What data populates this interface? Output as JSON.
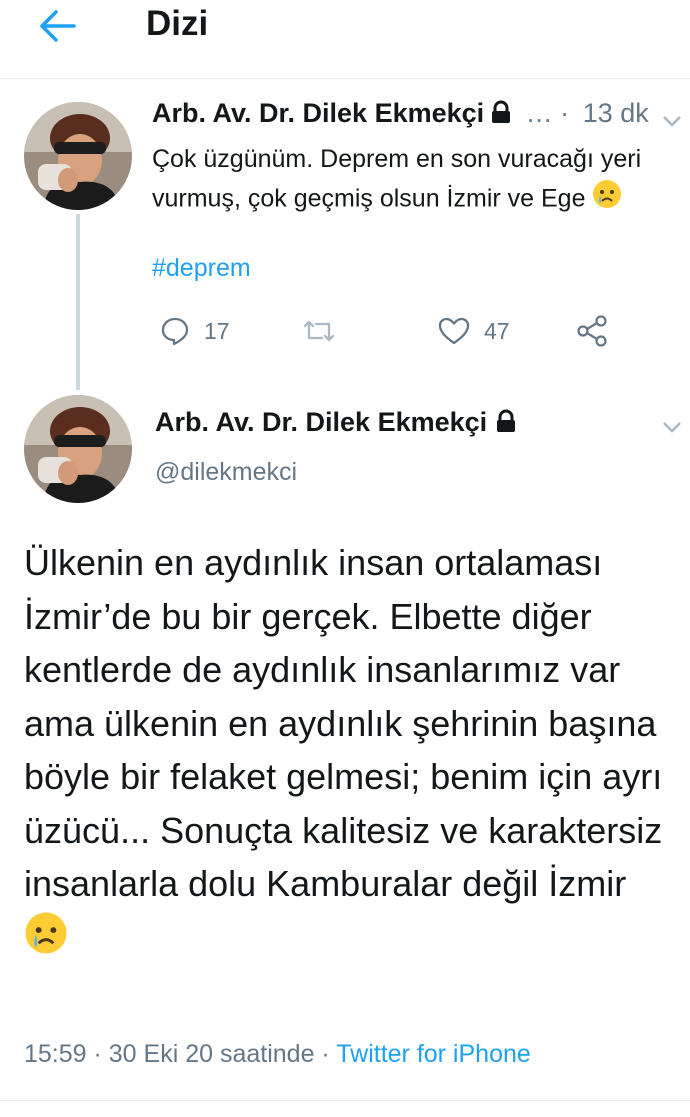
{
  "header": {
    "title": "Dizi",
    "back_icon": "arrow-left-icon"
  },
  "colors": {
    "accent": "#1da1f2",
    "secondary_text": "#657786",
    "primary_text": "#14171a",
    "divider": "#e6ecf0"
  },
  "reply_tweet": {
    "author": "Arb. Av. Dr. Dilek Ekmekçi",
    "separator": "… ·",
    "time": "13 dk",
    "text": "Çok üzgünüm. Deprem en son vuracağı yeri vurmuş, çok geçmiş olsun İzmir ve Ege",
    "emoji": "crying-face",
    "hashtag": "#deprem",
    "reply_count": "17",
    "like_count": "47"
  },
  "main_tweet": {
    "author": "Arb. Av. Dr. Dilek Ekmekçi",
    "handle": "@dilekmekci",
    "text": "Ülkenin en aydınlık insan ortalaması İzmir’de bu bir gerçek. Elbette diğer kentlerde de aydınlık insanlarımız var ama ülkenin en aydınlık şehrinin başına böyle bir felaket gelmesi; benim için ayrı üzücü... Sonuçta kalitesiz ve karaktersiz insanlarla dolu Kamburalar değil İzmir",
    "emoji": "crying-face",
    "timestamp": "15:59 · 30 Eki 20 saatinde ·",
    "source": "Twitter for iPhone"
  }
}
